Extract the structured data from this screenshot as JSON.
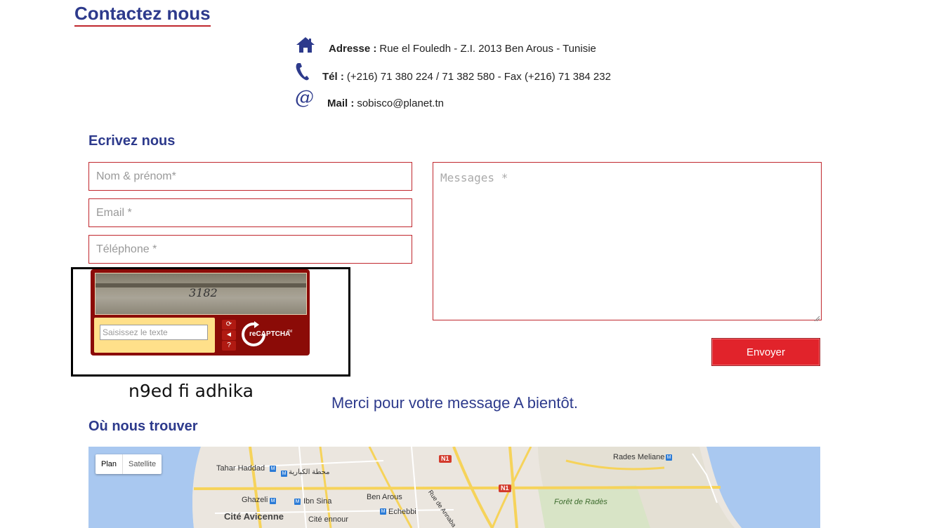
{
  "header": {
    "title": "Contactez nous"
  },
  "contact": {
    "address_label": "Adresse :",
    "address_value": "Rue el Fouledh - Z.I. 2013 Ben Arous - Tunisie",
    "tel_label": "Tél :",
    "tel_value": "(+216) 71 380 224 / 71 382 580 - Fax (+216) 71 384 232",
    "mail_label": "Mail :",
    "mail_value": "sobisco@planet.tn"
  },
  "form": {
    "title": "Ecrivez nous",
    "name_placeholder": "Nom & prénom*",
    "email_placeholder": "Email *",
    "phone_placeholder": "Téléphone *",
    "message_placeholder": "Messages *",
    "send_label": "Envoyer"
  },
  "captcha": {
    "image_text": "3182",
    "input_placeholder": "Saisissez le texte",
    "logo_text": "reCAPTCHA",
    "logo_tm": "TM"
  },
  "annotation": "n9ed fi adhika",
  "thanks_message": "Merci pour votre message A bientôt.",
  "map_section": {
    "title": "Où nous trouver",
    "type_plan": "Plan",
    "type_satellite": "Satellite",
    "labels": {
      "tahar_haddad": "Tahar Haddad",
      "arabic_station": "محطة الكبارية",
      "ghazeli": "Ghazeli",
      "ibn_sina": "Ibn Sina",
      "cite_avicenne": "Cité Avicenne",
      "cite_ennour": "Cité ennour",
      "ben_arous": "Ben Arous",
      "echebbi": "Echebbi",
      "rue_annaba": "Rue de Annaba",
      "rades_meliane": "Rades Meliane",
      "foret_rades": "Forêt de Radès",
      "n1": "N1"
    }
  },
  "colors": {
    "brand_blue": "#2d3a8c",
    "brand_red": "#c0272d",
    "button_red": "#e1232b"
  }
}
